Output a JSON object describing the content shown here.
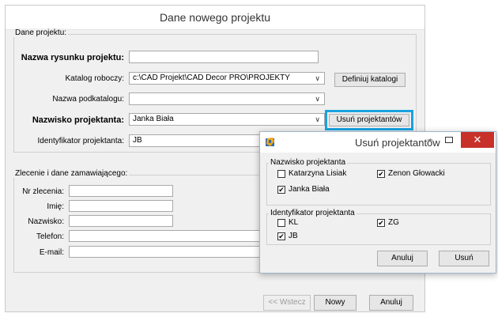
{
  "main_window": {
    "title": "Dane nowego projektu",
    "project_group": {
      "legend": "Dane projektu:",
      "drawing_name_label": "Nazwa rysunku projektu:",
      "drawing_name_value": "",
      "catalog_label": "Katalog roboczy:",
      "catalog_value": "c:\\CAD Projekt\\CAD Decor PRO\\PROJEKTY",
      "define_catalogs_button": "Definiuj katalogi",
      "subcatalog_label": "Nazwa podkatalogu:",
      "subcatalog_value": "",
      "designer_label": "Nazwisko projektanta:",
      "designer_value": "Janka Biała",
      "remove_designers_button": "Usuń projektantów",
      "designer_id_label": "Identyfikator projektanta:",
      "designer_id_value": "JB"
    },
    "order_group": {
      "legend": "Zlecenie i dane zamawiającego:",
      "order_no_label": "Nr zlecenia:",
      "first_name_label": "Imię:",
      "last_name_label": "Nazwisko:",
      "phone_label": "Telefon:",
      "email_label": "E-mail:"
    },
    "footer": {
      "back_button": "<< Wstecz",
      "new_button": "Nowy",
      "cancel_button": "Anuluj"
    }
  },
  "dialog": {
    "title": "Usuń projektantów",
    "names_group": {
      "legend": "Nazwisko projektanta",
      "items": [
        {
          "label": "Katarzyna Lisiak",
          "checked": false
        },
        {
          "label": "Zenon Głowacki",
          "checked": true
        },
        {
          "label": "Janka Biała",
          "checked": true
        }
      ]
    },
    "ids_group": {
      "legend": "Identyfikator projektanta",
      "items": [
        {
          "label": "KL",
          "checked": false
        },
        {
          "label": "ZG",
          "checked": true
        },
        {
          "label": "JB",
          "checked": true
        }
      ]
    },
    "cancel_button": "Anuluj",
    "remove_button": "Usuń"
  },
  "colors": {
    "highlight": "#19a2e0",
    "close_button": "#c7312a"
  }
}
